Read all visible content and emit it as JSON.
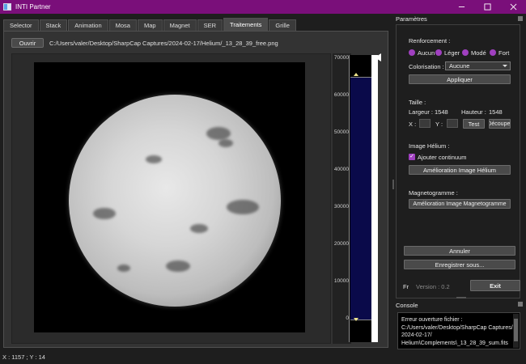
{
  "window": {
    "title": "INTI Partner",
    "controls": {
      "minimize": "minimize-icon",
      "maximize": "maximize-icon",
      "close": "close-icon"
    }
  },
  "tabs": [
    {
      "label": "Selector"
    },
    {
      "label": "Stack"
    },
    {
      "label": "Animation"
    },
    {
      "label": "Mosa"
    },
    {
      "label": "Map"
    },
    {
      "label": "Magnet"
    },
    {
      "label": "SER"
    },
    {
      "label": "Traitements",
      "active": true
    },
    {
      "label": "Grille"
    }
  ],
  "main": {
    "open_button": "Ouvrir",
    "file_path": "C:/Users/valer/Desktop/SharpCap Captures/2024-02-17/Helium/_13_28_39_free.png"
  },
  "histogram": {
    "ticks": [
      "70000",
      "60000",
      "50000",
      "40000",
      "30000",
      "20000",
      "10000",
      "0"
    ],
    "low_level": 0,
    "high_level": 65000
  },
  "params": {
    "title": "Paramètres",
    "renforcement": {
      "label": "Renforcement :",
      "options": [
        "Aucun",
        "Léger",
        "Modé",
        "Fort"
      ]
    },
    "colorisation": {
      "label": "Colorisation :",
      "value": "Aucune"
    },
    "apply_button": "Appliquer",
    "taille": {
      "label": "Taille :",
      "largeur_label": "Largeur :",
      "largeur_value": "1548",
      "hauteur_label": "Hauteur :",
      "hauteur_value": "1548",
      "x_label": "X :",
      "y_label": "Y :",
      "test_button": "Test",
      "crop_button": "Découper"
    },
    "helium": {
      "label": "Image Hélium :",
      "checkbox_label": "Ajouter continuum",
      "checked": true,
      "button": "Amélioration Image Hélium"
    },
    "magneto": {
      "label": "Magnetogramme :",
      "button": "Amélioration Image  Magnetogramme"
    },
    "cancel_button": "Annuler",
    "save_button": "Enregistrer sous...",
    "lang": "Fr",
    "version": "Version : 0.2",
    "exit_button": "Exit"
  },
  "console": {
    "title": "Console",
    "text": "Erreur ouverture fichier :\nC:/Users/valer/Desktop/SharpCap Captures/\n2024-02-17/\nHelium\\Complements\\_13_28_39_sum.fits"
  },
  "status": {
    "coords": "X : 1157 ; Y : 14"
  },
  "colors": {
    "titlebar": "#7a0f7a",
    "accent": "#a040c0",
    "histogram_fill": "#0a0a4a"
  }
}
